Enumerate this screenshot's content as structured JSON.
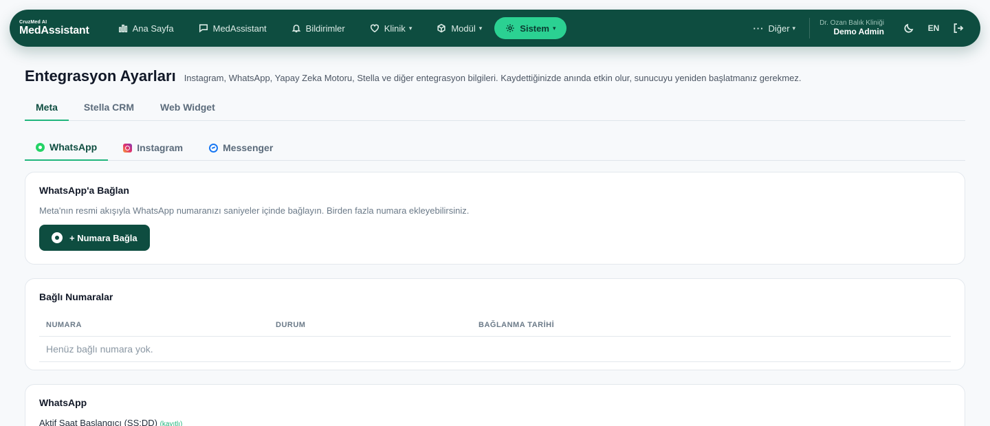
{
  "brand": {
    "small": "CruzMed AI",
    "name": "MedAssistant"
  },
  "nav": {
    "items": [
      {
        "label": "Ana Sayfa",
        "icon": "chart-icon"
      },
      {
        "label": "MedAssistant",
        "icon": "chat-icon"
      },
      {
        "label": "Bildirimler",
        "icon": "bell-icon"
      },
      {
        "label": "Klinik",
        "icon": "heart-icon",
        "caret": "▾"
      },
      {
        "label": "Modül",
        "icon": "cube-icon",
        "caret": "▾"
      },
      {
        "label": "Sistem",
        "icon": "gear-icon",
        "caret": "▾",
        "active": true
      }
    ],
    "more_label": "Diğer",
    "more_dots": "···",
    "caret": "▾",
    "clinic": "Dr. Ozan Balık Kliniği",
    "user": "Demo Admin",
    "lang": "EN"
  },
  "page": {
    "title": "Entegrasyon Ayarları",
    "description": "Instagram, WhatsApp, Yapay Zeka Motoru, Stella ve diğer entegrasyon bilgileri. Kaydettiğinizde anında etkin olur, sunucuyu yeniden başlatmanız gerekmez."
  },
  "tabs": [
    "Meta",
    "Stella CRM",
    "Web Widget"
  ],
  "subtabs": [
    "WhatsApp",
    "Instagram",
    "Messenger"
  ],
  "connect_card": {
    "title": "WhatsApp'a Bağlan",
    "subtitle": "Meta'nın resmi akışıyla WhatsApp numaranızı saniyeler içinde bağlayın. Birden fazla numara ekleyebilirsiniz.",
    "button": "+ Numara Bağla"
  },
  "numbers_card": {
    "title": "Bağlı Numaralar",
    "columns": [
      "NUMARA",
      "DURUM",
      "BAĞLANMA TARİHİ"
    ],
    "empty": "Henüz bağlı numara yok."
  },
  "whatsapp_card": {
    "title": "WhatsApp",
    "field_label": "Aktif Saat Başlangıcı (SS:DD)",
    "field_tag": "(kayıtlı)"
  },
  "colors": {
    "primary": "#0e4d40",
    "accent": "#2bd192",
    "background": "#f7f9fb"
  }
}
